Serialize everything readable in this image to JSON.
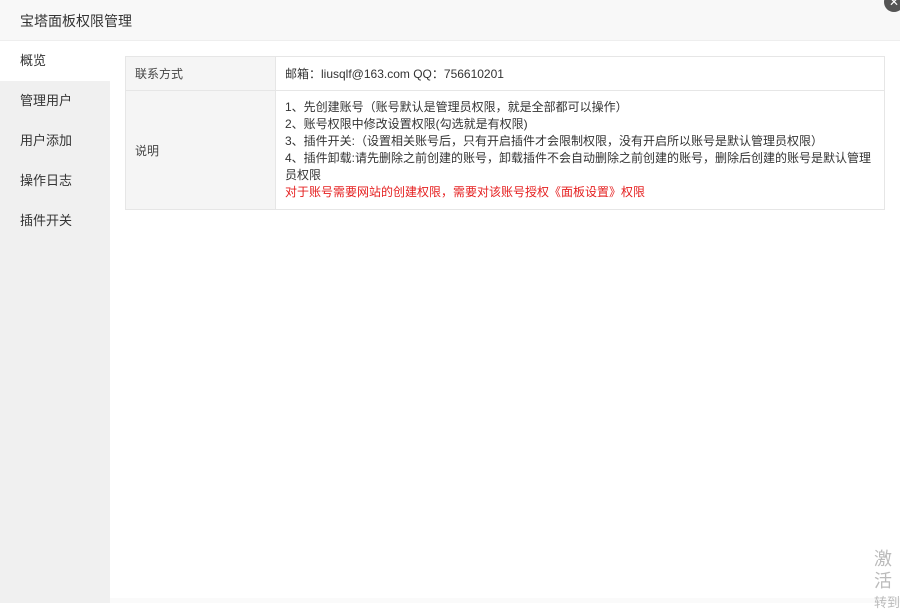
{
  "dialog": {
    "title": "宝塔面板权限管理"
  },
  "sidebar": {
    "items": [
      {
        "label": "概览",
        "active": true
      },
      {
        "label": "管理用户",
        "active": false
      },
      {
        "label": "用户添加",
        "active": false
      },
      {
        "label": "操作日志",
        "active": false
      },
      {
        "label": "插件开关",
        "active": false
      }
    ]
  },
  "info_table": {
    "contact_label": "联系方式",
    "contact_value": "邮箱：liusqlf@163.com  QQ：756610201",
    "notes_label": "说明",
    "notes": [
      "1、先创建账号（账号默认是管理员权限，就是全部都可以操作）",
      "2、账号权限中修改设置权限(勾选就是有权限)",
      "3、插件开关:（设置相关账号后，只有开启插件才会限制权限，没有开启所以账号是默认管理员权限）",
      "4、插件卸载:请先删除之前创建的账号，卸载插件不会自动删除之前创建的账号，删除后创建的账号是默认管理员权限"
    ],
    "notes_warning": "对于账号需要网站的创建权限，需要对该账号授权《面板设置》权限"
  },
  "watermark": {
    "line1": "激活",
    "line2": "转到"
  },
  "colors": {
    "warning": "#e52020",
    "sidebar_bg": "#f0f0f0"
  }
}
